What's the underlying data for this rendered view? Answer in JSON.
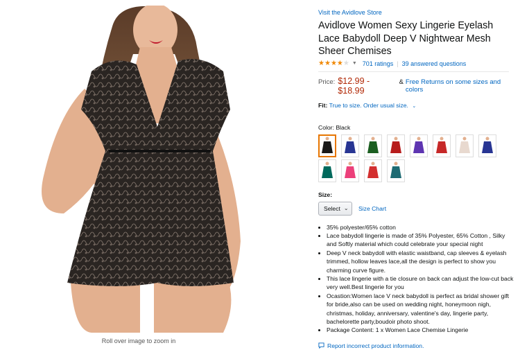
{
  "store_link": "Visit the Avidlove Store",
  "title": "Avidlove Women Sexy Lingerie Eyelash Lace Babydoll Deep V Nightwear Mesh Sheer Chemises",
  "rating": {
    "stars": 4.2,
    "ratings_text": "701 ratings",
    "separator": "|",
    "answered_text": "39 answered questions"
  },
  "price": {
    "label": "Price:",
    "value": "$12.99 - $18.99",
    "amp": "&",
    "returns": "Free Returns on some sizes and colors"
  },
  "fit": {
    "label": "Fit:",
    "value": "True to size. Order usual size."
  },
  "color": {
    "label": "Color:",
    "selected": "Black",
    "swatches": [
      "#1a1a1a",
      "#283593",
      "#1b5e20",
      "#b71c1c",
      "#5e35b1",
      "#c62828",
      "#e8d9cf",
      "#283593",
      "#00695c",
      "#ec407a",
      "#d32f2f",
      "#1e6b73"
    ]
  },
  "size": {
    "label": "Size:",
    "select_value": "Select",
    "chart_link": "Size Chart"
  },
  "bullets": [
    "35% polyester/65% cotton",
    "Lace babydoll lingerie is made of 35% Polyester, 65% Cotton , Silky and Softly material which could celebrate your special night",
    "Deep V neck babydoll with elastic waistband, cap sleeves & eyelash trimmed, hollow leaves lace,all the design is perfect to show you charming curve figure.",
    "This lace lingerie with a tie closure on back can adjust the low-cut back very well.Best lingerie for you",
    "Ocastion:Women lace V neck babydoll is perfect as bridal shower gift for bride,also can be used on wedding night, honeymoon nigh, christmas, holiday, anniversary, valentine's day, lingerie party, bachelorette party,boudoir photo shoot.",
    "Package Content: 1 x Women Lace Chemise Lingerie"
  ],
  "report_link": "Report incorrect product information.",
  "zoom_hint": "Roll over image to zoom in",
  "colors": {
    "link": "#0066c0",
    "price": "#b12704",
    "star": "#f08804",
    "selected_border": "#e77600"
  }
}
